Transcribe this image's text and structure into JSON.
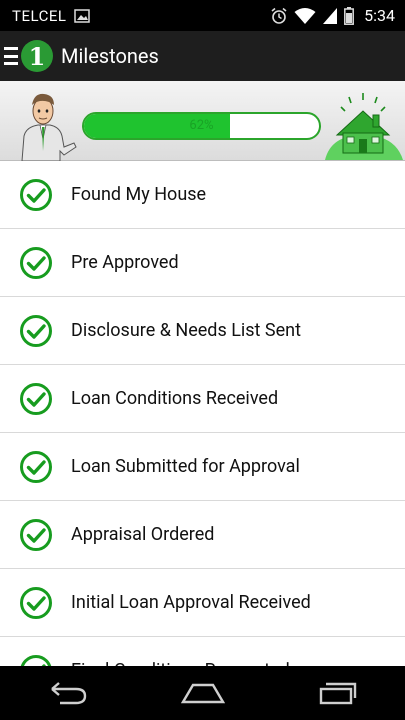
{
  "status_bar": {
    "carrier": "TELCEL",
    "time": "5:34",
    "icons": [
      "image-icon",
      "alarm-icon",
      "wifi-icon",
      "signal-icon",
      "battery-icon"
    ]
  },
  "action_bar": {
    "logo_text": "1",
    "title": "Milestones",
    "icons": [
      "menu-icon",
      "app-logo-icon"
    ]
  },
  "progress": {
    "value": 0.62,
    "label": "62%",
    "colors": {
      "fill": "#1fc32f",
      "border": "#2ba52b",
      "track": "#ffffff"
    },
    "illustrations": [
      "man-character-illustration",
      "house-illustration"
    ]
  },
  "milestones": [
    {
      "label": "Found My House",
      "status": "complete"
    },
    {
      "label": "Pre Approved",
      "status": "complete"
    },
    {
      "label": "Disclosure & Needs List Sent",
      "status": "complete"
    },
    {
      "label": "Loan Conditions Received",
      "status": "complete"
    },
    {
      "label": "Loan Submitted for Approval",
      "status": "complete"
    },
    {
      "label": "Appraisal Ordered",
      "status": "complete"
    },
    {
      "label": "Initial Loan Approval Received",
      "status": "complete"
    },
    {
      "label": "Final Conditions Requested",
      "status": "partial"
    }
  ],
  "nav_bar": {
    "icons": [
      "back-icon",
      "home-icon",
      "recent-apps-icon"
    ]
  },
  "colors": {
    "accent": "#179c1f",
    "action_bar": "#1e1e1e",
    "status_bar": "#000000"
  }
}
